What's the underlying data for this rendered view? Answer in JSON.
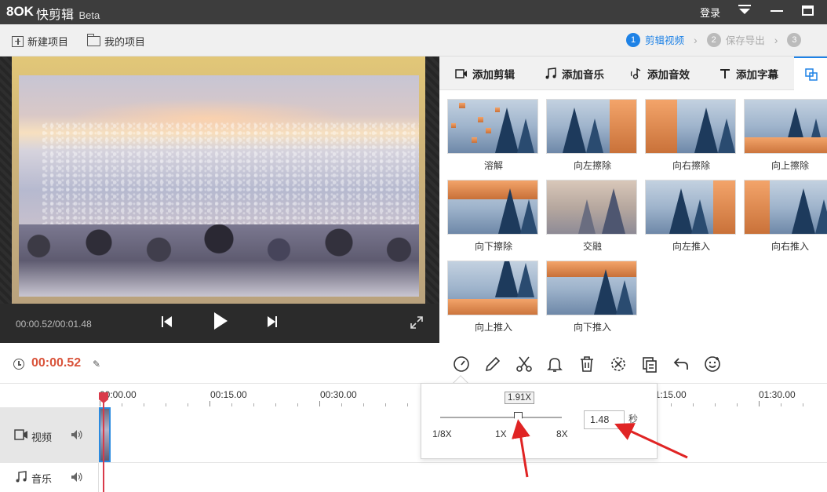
{
  "app": {
    "logo": "8OK",
    "name": "快剪辑",
    "edition": "Beta",
    "login_label": "登录"
  },
  "toolbar": {
    "new_project": "新建项目",
    "my_projects": "我的项目",
    "steps": [
      {
        "num": "1",
        "label": "剪辑视频",
        "active": true
      },
      {
        "num": "2",
        "label": "保存导出",
        "active": false
      },
      {
        "num": "3",
        "label": "",
        "active": false
      }
    ]
  },
  "preview": {
    "time": "00:00.52/00:01.48"
  },
  "tabs": [
    {
      "label": "添加剪辑",
      "icon": "video-camera-icon"
    },
    {
      "label": "添加音乐",
      "icon": "music-note-icon"
    },
    {
      "label": "添加音效",
      "icon": "sound-effect-icon"
    },
    {
      "label": "添加字幕",
      "icon": "text-t-icon"
    },
    {
      "label": "",
      "icon": "transition-icon",
      "active": true
    }
  ],
  "transitions": [
    {
      "label": "溶解"
    },
    {
      "label": "向左擦除"
    },
    {
      "label": "向右擦除"
    },
    {
      "label": "向上擦除"
    },
    {
      "label": "向下擦除"
    },
    {
      "label": "交融"
    },
    {
      "label": "向左推入"
    },
    {
      "label": "向右推入"
    },
    {
      "label": "向上推入"
    },
    {
      "label": "向下推入"
    }
  ],
  "timeline": {
    "current_time": "00:00.52",
    "ruler": [
      "00:00.00",
      "00:15.00",
      "00:30.00",
      "01:15.00",
      "01:30.00"
    ],
    "tracks": {
      "video": "视频",
      "music": "音乐"
    }
  },
  "speed_popup": {
    "tooltip": "1.91X",
    "min_label": "1/8X",
    "mid_label": "1X",
    "max_label": "8X",
    "duration_value": "1.48",
    "unit": "秒",
    "speed_value": 1.91
  },
  "colors": {
    "accent": "#1e82e6",
    "time_red": "#d9533a",
    "annotation_red": "#e02424"
  }
}
